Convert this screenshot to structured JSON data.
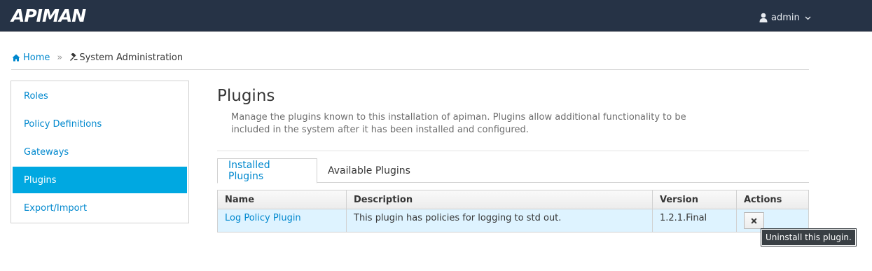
{
  "navbar": {
    "brand": "APIMAN",
    "user": {
      "name": "admin",
      "icon": "user-icon"
    }
  },
  "breadcrumb": {
    "home": "Home",
    "separator": "»",
    "current": "System Administration"
  },
  "sidebar": {
    "items": [
      {
        "label": "Roles",
        "active": false
      },
      {
        "label": "Policy Definitions",
        "active": false
      },
      {
        "label": "Gateways",
        "active": false
      },
      {
        "label": "Plugins",
        "active": true
      },
      {
        "label": "Export/Import",
        "active": false
      }
    ]
  },
  "main": {
    "title": "Plugins",
    "description": "Manage the plugins known to this installation of apiman. Plugins allow additional functionality to be included in the system after it has been installed and configured.",
    "tabs": [
      {
        "label": "Installed Plugins",
        "active": true
      },
      {
        "label": "Available Plugins",
        "active": false
      }
    ],
    "table": {
      "columns": [
        "Name",
        "Description",
        "Version",
        "Actions"
      ],
      "rows": [
        {
          "name": "Log Policy Plugin",
          "description": "This plugin has policies for logging to std out.",
          "version": "1.2.1.Final",
          "action_icon": "close-icon"
        }
      ]
    },
    "tooltip": "Uninstall this plugin."
  },
  "colors": {
    "navbar_bg": "#263346",
    "accent": "#0088ce",
    "active_item_bg": "#00a8e1",
    "selected_row_bg": "#def3ff"
  }
}
